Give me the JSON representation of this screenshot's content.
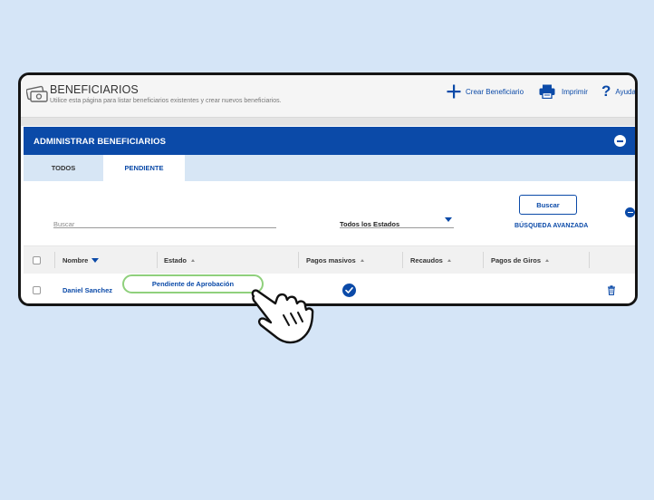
{
  "header": {
    "title": "BENEFICIARIOS",
    "subtitle": "Utilice esta página para listar beneficiarios existentes y crear nuevos beneficiarios.",
    "actions": {
      "create": "Crear Beneficiario",
      "print": "Imprimir",
      "help": "Ayuda"
    },
    "icons": {
      "beneficiaries": "money-icon",
      "create": "plus-icon",
      "print": "printer-icon",
      "help": "question-icon"
    }
  },
  "panel": {
    "title": "ADMINISTRAR BENEFICIARIOS",
    "tabs": [
      {
        "label": "TODOS",
        "active": false
      },
      {
        "label": "PENDIENTE",
        "active": true
      }
    ]
  },
  "filters": {
    "search_placeholder": "Buscar",
    "status_select": "Todos los Estados",
    "search_button": "Buscar",
    "advanced_search": "BÚSQUEDA AVANZADA"
  },
  "table": {
    "columns": {
      "nombre": "Nombre",
      "estado": "Estado",
      "pagos_masivos": "Pagos masivos",
      "recaudos": "Recaudos",
      "pagos_giros": "Pagos de Giros"
    },
    "rows": [
      {
        "nombre": "Daniel Sanchez",
        "estado": "Pendiente de Aprobación",
        "pagos_masivos": true,
        "recaudos": false,
        "pagos_giros": false
      }
    ]
  },
  "colors": {
    "primary": "#0b4aa8",
    "background": "#d5e5f7",
    "tab_bar": "#d7e6f5",
    "highlight": "#8fd07c"
  }
}
